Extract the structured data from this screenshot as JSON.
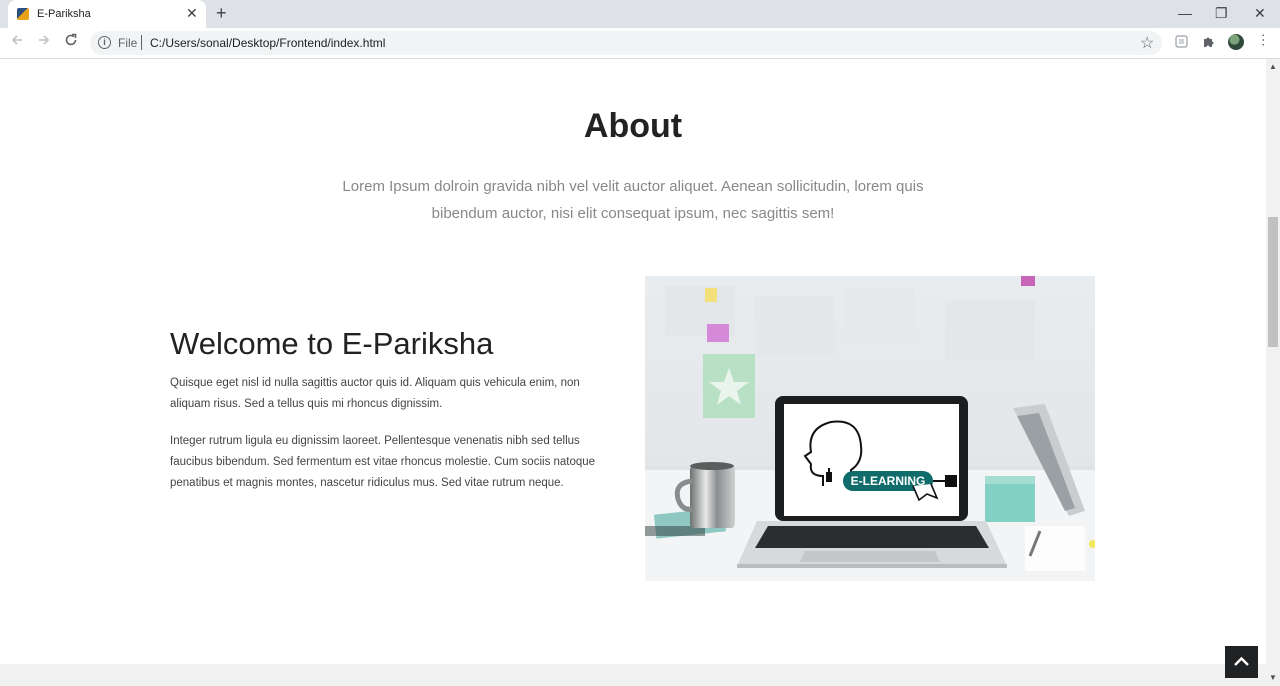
{
  "browser": {
    "tab_title": "E-Pariksha",
    "tab_close": "✕",
    "new_tab": "+",
    "url_scheme_label": "File",
    "url": "C:/Users/sonal/Desktop/Frontend/index.html",
    "window_controls": {
      "minimize": "—",
      "restore": "❐",
      "close": "✕"
    }
  },
  "about": {
    "title": "About",
    "subtitle": "Lorem Ipsum dolroin gravida nibh vel velit auctor aliquet. Aenean sollicitudin, lorem quis bibendum auctor, nisi elit consequat ipsum, nec sagittis sem!"
  },
  "welcome": {
    "heading": "Welcome to E-Pariksha",
    "paragraph1": "Quisque eget nisl id nulla sagittis auctor quis id. Aliquam quis vehicula enim, non aliquam risus. Sed a tellus quis mi rhoncus dignissim.",
    "paragraph2": "Integer rutrum ligula eu dignissim laoreet. Pellentesque venenatis nibh sed tellus faucibus bibendum. Sed fermentum est vitae rhoncus molestie. Cum sociis natoque penatibus et magnis montes, nascetur ridiculus mus. Sed vitae rutrum neque.",
    "image_label": "E-LEARNING"
  },
  "icons": {
    "back": "arrow-left-icon",
    "forward": "arrow-right-icon",
    "reload": "reload-icon",
    "info": "info-icon",
    "bookmark": "star-icon",
    "extensions": "puzzle-icon",
    "menu": "kebab-menu-icon",
    "scroll_to_top": "chevron-up-icon"
  },
  "colors": {
    "tab_strip": "#dee1e6",
    "omnibox": "#f1f3f4",
    "heading_text": "#222222",
    "muted_text": "#888888",
    "elearning_badge": "#0f6c6b",
    "scroll_top_button": "#1f2122"
  }
}
